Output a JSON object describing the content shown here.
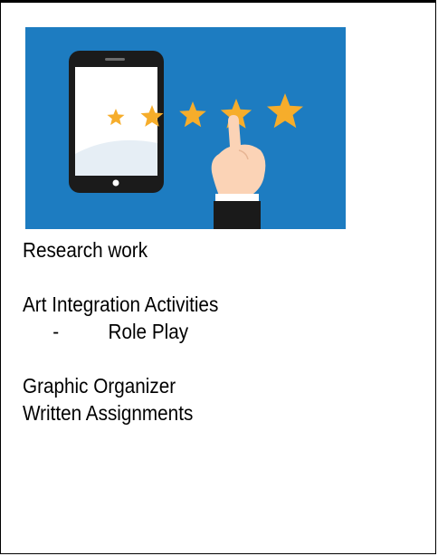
{
  "colors": {
    "panel_blue": "#1d7cc1",
    "star_orange": "#f6ad2b",
    "phone_body": "#1b1b1b",
    "hand_skin": "#fbd3b6",
    "sleeve": "#1a1a1a"
  },
  "illustration": {
    "icons": [
      "tablet-icon",
      "star-icon",
      "pointing-hand-icon"
    ],
    "rating_stars": 5
  },
  "content": {
    "line1": "Research work",
    "line2": "Art Integration Activities",
    "bullet_dash": "-",
    "bullet_text": "Role Play",
    "line3": "Graphic Organizer",
    "line4": "Written Assignments"
  }
}
